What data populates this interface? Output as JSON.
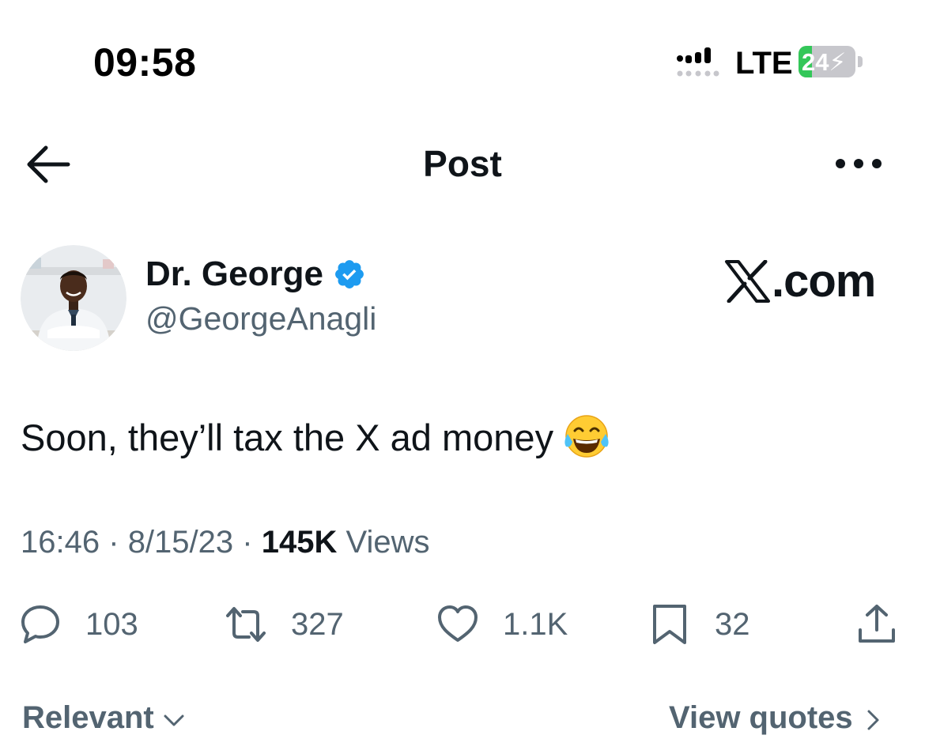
{
  "status_bar": {
    "time": "09:58",
    "network": "LTE",
    "battery_percent": "24",
    "battery_level": 0.24
  },
  "nav": {
    "title": "Post"
  },
  "author": {
    "display_name": "Dr. George",
    "handle": "@GeorgeAnagli",
    "verified": true
  },
  "watermark": {
    "text": ".com"
  },
  "tweet": {
    "text": "Soon, they’ll tax the X ad money",
    "emoji": "face-with-tears-of-joy"
  },
  "meta": {
    "time": "16:46",
    "separator": "·",
    "date": "8/15/23",
    "views_count": "145K",
    "views_label": "Views"
  },
  "actions": {
    "replies": "103",
    "reposts": "327",
    "likes": "1.1K",
    "bookmarks": "32"
  },
  "footer": {
    "sort_label": "Relevant",
    "quotes_label": "View quotes"
  },
  "colors": {
    "text_primary": "#0f1419",
    "text_secondary": "#536471",
    "verified_blue": "#1d9bf0",
    "battery_green": "#34c759"
  }
}
